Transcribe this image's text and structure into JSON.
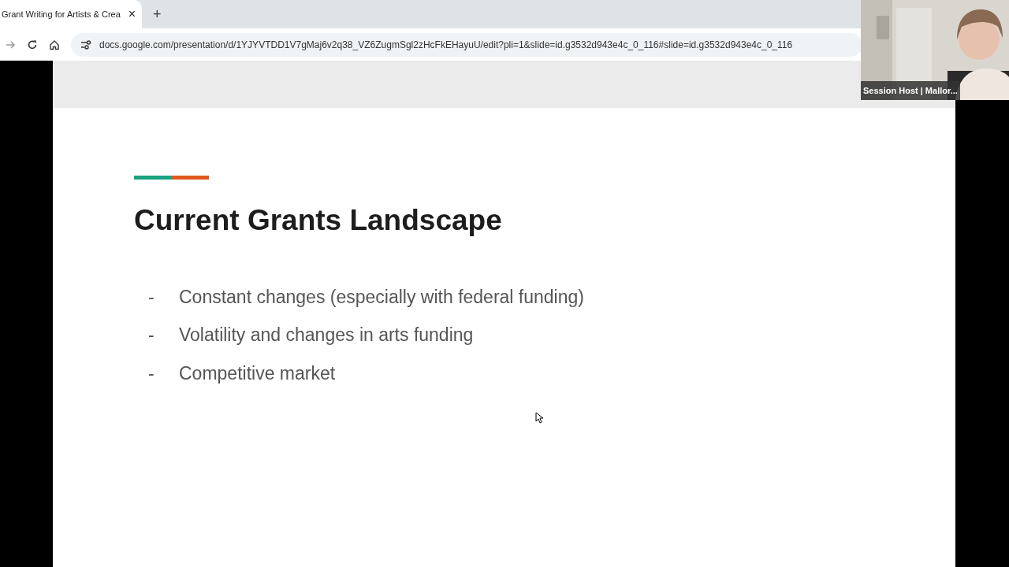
{
  "browser": {
    "tabs": [
      {
        "title": "Grant Writing for Artists & Crea",
        "close": "×",
        "selected": true
      }
    ],
    "new_tab": "+",
    "address": "docs.google.com/presentation/d/1YJYVTDD1V7gMaj6v2q38_VZ6ZugmSgl2zHcFkEHayuU/edit?pli=1&slide=id.g3532d943e4c_0_116#slide=id.g3532d943e4c_0_116"
  },
  "slide": {
    "title": "Current Grants Landscape",
    "accent_segments": [
      {
        "color": "#1aa37f"
      },
      {
        "color": "#e0591f"
      }
    ],
    "bullets": [
      {
        "marker": "-",
        "text": "Constant changes (especially with federal funding)"
      },
      {
        "marker": "-",
        "text": "Volatility and changes in arts funding"
      },
      {
        "marker": "-",
        "text": "Competitive market"
      }
    ]
  },
  "video": {
    "kind": "picture",
    "label": "Session Host | Mallor..."
  }
}
